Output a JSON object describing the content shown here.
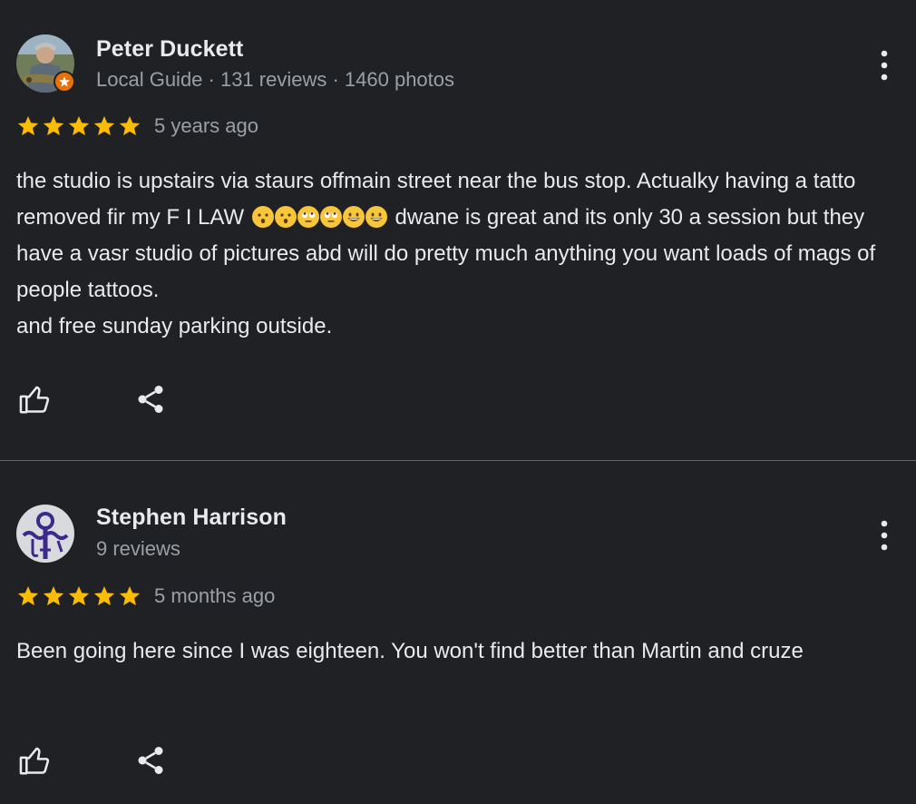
{
  "colors": {
    "background": "#202124",
    "text_primary": "#e8eaed",
    "text_secondary": "#9aa0a6",
    "star": "#fbbc04",
    "local_guide_badge": "#e8710a",
    "divider": "#5f6368"
  },
  "reviews": [
    {
      "author": "Peter Duckett",
      "meta": "Local Guide · 131 reviews · 1460 photos",
      "rating": 5,
      "date": "5 years ago",
      "text_before_emoji": "the studio is upstairs via staurs offmain street near the bus stop. Actualky having a tatto removed fir my F I LAW ",
      "emojis": [
        "hushed-face",
        "hushed-face",
        "rolling-eyes-face",
        "rolling-eyes-face",
        "grinning-face",
        "grinning-face"
      ],
      "text_after_emoji": " dwane is great and its only 30 a session but they have a vasr studio of pictures abd will do pretty much anything you want loads of mags of people tattoos.\nand free sunday parking outside.",
      "icons": {
        "more": "more-vert-icon",
        "like": "thumb-up-icon",
        "share": "share-icon",
        "badge": "local-guide-star-icon"
      }
    },
    {
      "author": "Stephen Harrison",
      "meta": "9 reviews",
      "rating": 5,
      "date": "5 months ago",
      "text": "Been going here since I was eighteen. You won't find better than Martin and cruze",
      "icons": {
        "more": "more-vert-icon",
        "like": "thumb-up-icon",
        "share": "share-icon"
      }
    }
  ]
}
